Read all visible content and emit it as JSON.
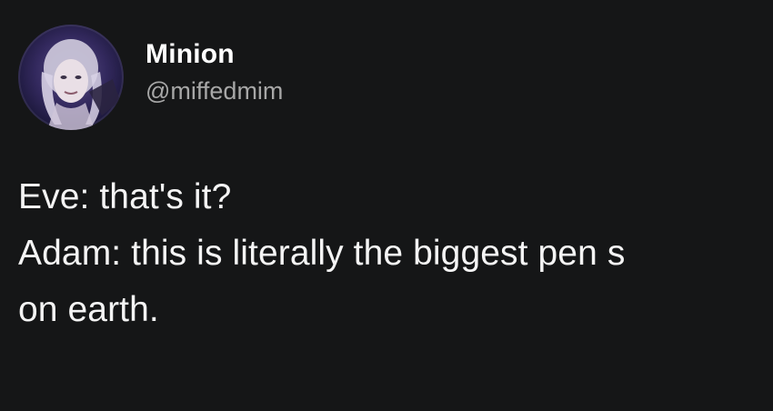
{
  "author": {
    "display_name": "Minion",
    "handle": "@miffedmim",
    "avatar_icon": "profile-photo-avatar"
  },
  "tweet": {
    "lines": [
      "Eve: that's it?",
      "Adam: this is literally the biggest pen s",
      "on earth."
    ]
  },
  "colors": {
    "background": "#151617",
    "text": "#f4f4f4",
    "handle": "#a7a7a7"
  }
}
